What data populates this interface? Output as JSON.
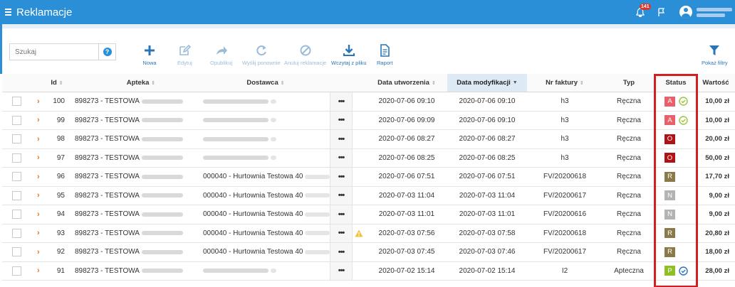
{
  "header": {
    "title": "Reklamacje",
    "notification_count": "141"
  },
  "toolbar": {
    "search_placeholder": "Szukaj",
    "help": "?",
    "buttons": [
      {
        "label": "Nowa",
        "icon": "plus-icon",
        "enabled": true
      },
      {
        "label": "Edytuj",
        "icon": "edit-icon",
        "enabled": false
      },
      {
        "label": "Opublikuj",
        "icon": "share-icon",
        "enabled": false
      },
      {
        "label": "Wyślij ponownie",
        "icon": "refresh-icon",
        "enabled": false
      },
      {
        "label": "Anuluj reklamacje",
        "icon": "cancel-icon",
        "enabled": false
      },
      {
        "label": "Wczytaj z pliku",
        "icon": "download-icon",
        "enabled": true
      },
      {
        "label": "Raport",
        "icon": "document-icon",
        "enabled": true
      }
    ],
    "filter_label": "Pokaż filtry"
  },
  "table": {
    "columns": {
      "id": "Id",
      "apteka": "Apteka",
      "dostawca": "Dostawca",
      "data_utworzenia": "Data utworzenia",
      "data_modyfikacji": "Data modyfikacji",
      "nr_faktury": "Nr faktury",
      "typ": "Typ",
      "status": "Status",
      "wartosc": "Wartość"
    },
    "rows": [
      {
        "id": "100",
        "apteka": "898273 - TESTOWA",
        "dostawca": "",
        "warn": false,
        "created": "2020-07-06 09:10",
        "modified": "2020-07-06 09:10",
        "invoice": "h3",
        "type": "Ręczna",
        "status": "A",
        "status_color": "#e8606a",
        "status_icon": "check-circle-green-icon",
        "amount": "10,00 zł"
      },
      {
        "id": "99",
        "apteka": "898273 - TESTOWA",
        "dostawca": "",
        "warn": false,
        "created": "2020-07-06 09:09",
        "modified": "2020-07-06 09:10",
        "invoice": "h3",
        "type": "Ręczna",
        "status": "A",
        "status_color": "#e8606a",
        "status_icon": "check-circle-green-icon",
        "amount": "10,00 zł"
      },
      {
        "id": "98",
        "apteka": "898273 - TESTOWA",
        "dostawca": "",
        "warn": false,
        "created": "2020-07-06 08:27",
        "modified": "2020-07-06 08:27",
        "invoice": "h3",
        "type": "Ręczna",
        "status": "O",
        "status_color": "#b01215",
        "status_icon": "",
        "amount": "20,00 zł"
      },
      {
        "id": "97",
        "apteka": "898273 - TESTOWA",
        "dostawca": "",
        "warn": false,
        "created": "2020-07-06 08:25",
        "modified": "2020-07-06 08:25",
        "invoice": "h3",
        "type": "Ręczna",
        "status": "O",
        "status_color": "#b01215",
        "status_icon": "",
        "amount": "50,00 zł"
      },
      {
        "id": "96",
        "apteka": "898273 - TESTOWA",
        "dostawca": "000040 - Hurtownia Testowa 40",
        "warn": false,
        "created": "2020-07-06 07:51",
        "modified": "2020-07-06 07:51",
        "invoice": "FV/20200618",
        "type": "Ręczna",
        "status": "R",
        "status_color": "#8a7a4a",
        "status_icon": "",
        "amount": "17,70 zł"
      },
      {
        "id": "95",
        "apteka": "898273 - TESTOWA",
        "dostawca": "000040 - Hurtownia Testowa 40",
        "warn": false,
        "created": "2020-07-03 11:04",
        "modified": "2020-07-03 11:04",
        "invoice": "FV/20200617",
        "type": "Ręczna",
        "status": "N",
        "status_color": "#b3b3b3",
        "status_icon": "",
        "amount": "9,00 zł"
      },
      {
        "id": "94",
        "apteka": "898273 - TESTOWA",
        "dostawca": "000040 - Hurtownia Testowa 40",
        "warn": false,
        "created": "2020-07-03 11:01",
        "modified": "2020-07-03 11:01",
        "invoice": "FV/20200616",
        "type": "Ręczna",
        "status": "N",
        "status_color": "#b3b3b3",
        "status_icon": "",
        "amount": "9,00 zł"
      },
      {
        "id": "93",
        "apteka": "898273 - TESTOWA",
        "dostawca": "000040 - Hurtownia Testowa 40",
        "warn": true,
        "created": "2020-07-03 07:56",
        "modified": "2020-07-03 07:58",
        "invoice": "FV/20200618",
        "type": "Ręczna",
        "status": "R",
        "status_color": "#8a7a4a",
        "status_icon": "",
        "amount": "20,80 zł"
      },
      {
        "id": "92",
        "apteka": "898273 - TESTOWA",
        "dostawca": "000040 - Hurtownia Testowa 40",
        "warn": false,
        "created": "2020-07-03 07:45",
        "modified": "2020-07-03 07:46",
        "invoice": "FV/20200617",
        "type": "Ręczna",
        "status": "R",
        "status_color": "#8a7a4a",
        "status_icon": "",
        "amount": "18,00 zł"
      },
      {
        "id": "91",
        "apteka": "898273 - TESTOWA",
        "dostawca": "",
        "warn": false,
        "created": "2020-07-02 15:14",
        "modified": "2020-07-02 15:14",
        "invoice": "I2",
        "type": "Apteczna",
        "status": "P",
        "status_color": "#8fbf22",
        "status_icon": "check-circle-blue-icon",
        "amount": "28,00 zł"
      }
    ]
  }
}
